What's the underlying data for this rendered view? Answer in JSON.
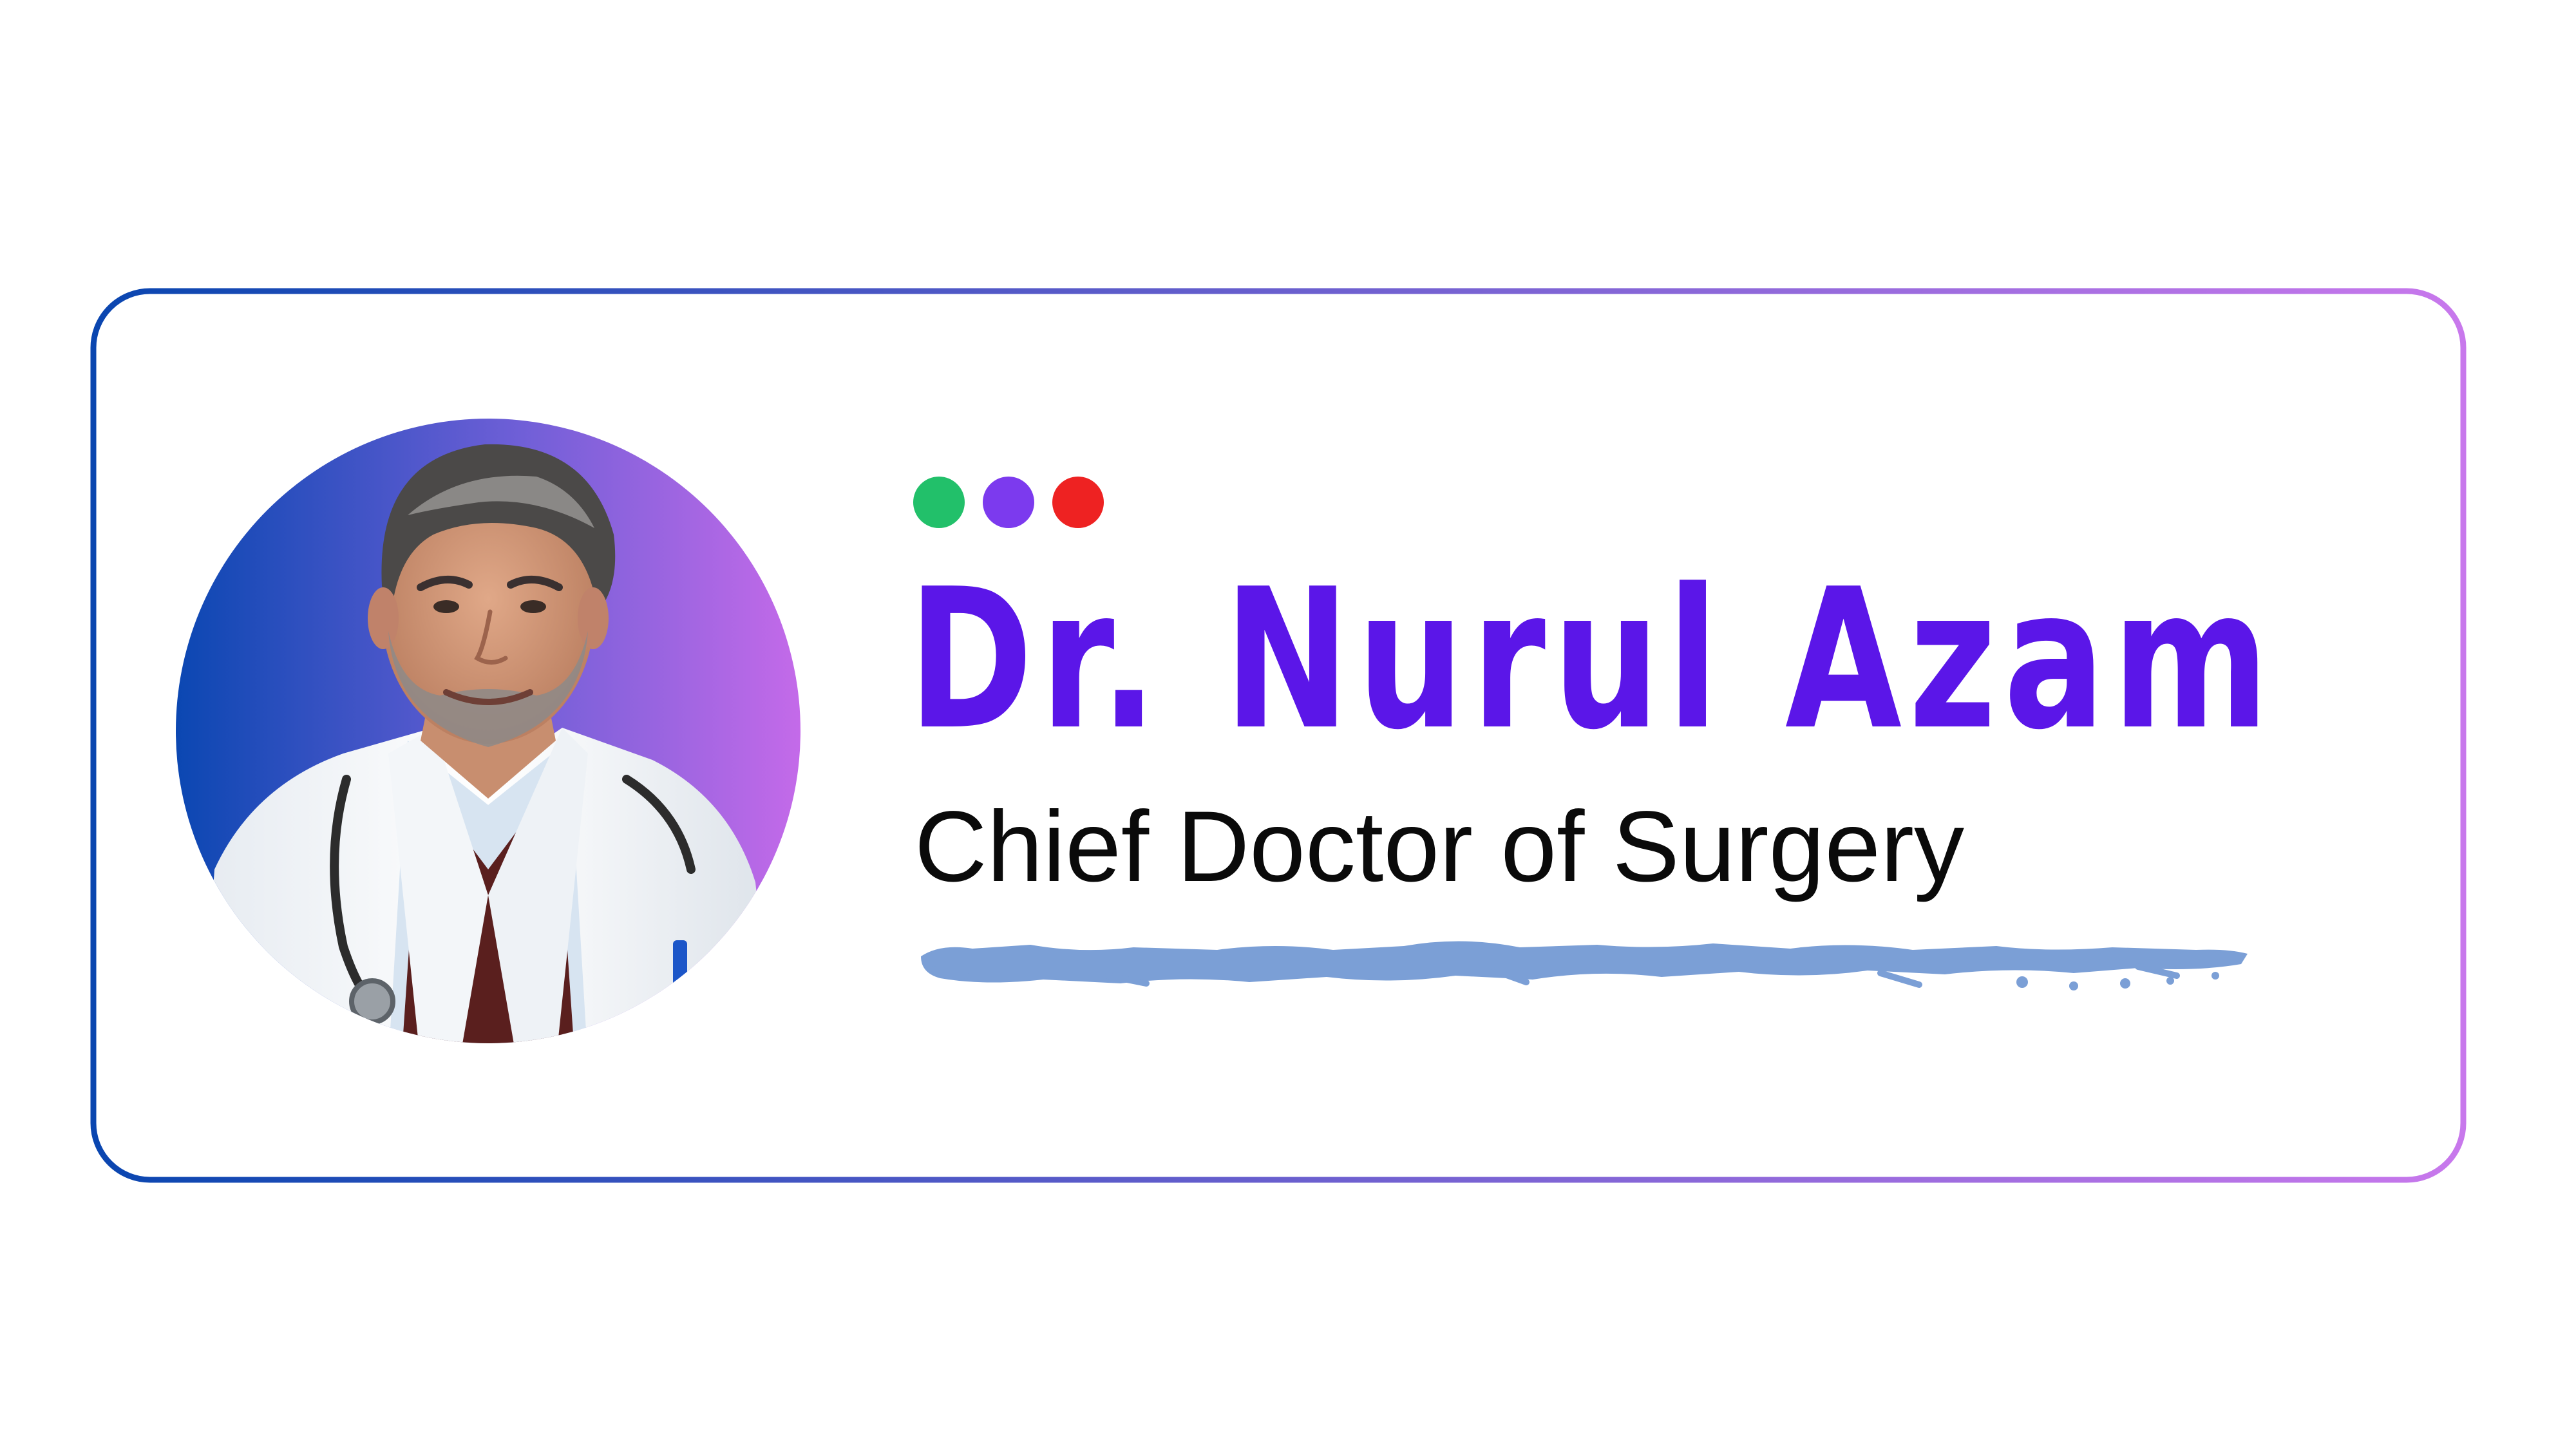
{
  "card": {
    "name": "Dr. Nurul Azam",
    "title": "Chief Doctor of Surgery"
  },
  "colors": {
    "name_text": "#5b16e8",
    "border_gradient_start": "#0a46b0",
    "border_gradient_end": "#c878ec",
    "avatar_gradient_start": "#0b47b2",
    "avatar_gradient_end": "#c46ae9",
    "brush_stroke": "#7b9fd6",
    "dot_1": "#22c06a",
    "dot_2": "#7c3aee",
    "dot_3": "#ee2222"
  },
  "decor": {
    "dots": [
      "green-dot",
      "purple-dot",
      "red-dot"
    ],
    "portrait": "doctor-portrait",
    "underline": "brush-stroke"
  }
}
